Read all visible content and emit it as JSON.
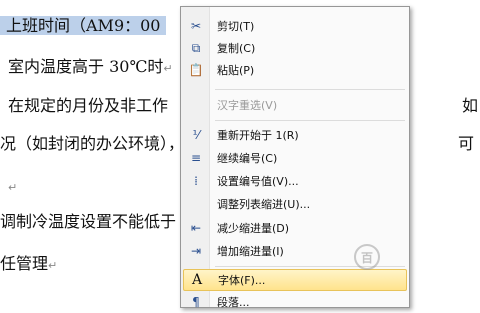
{
  "document": {
    "lines": [
      {
        "text": "上班时间（AM9：00"
      },
      {
        "text": "室内温度高于 30℃时"
      },
      {
        "text": "在规定的月份及非工作"
      },
      {
        "text": "况（如封闭的办公环境），"
      },
      {
        "text": ""
      },
      {
        "text": "调制冷温度设置不能低于"
      },
      {
        "text": "任管理"
      }
    ],
    "right_fragments": {
      "a": "如",
      "b": "可"
    }
  },
  "context_menu": {
    "items": [
      {
        "label": "剪切(T)",
        "icon": "scissors-icon"
      },
      {
        "label": "复制(C)",
        "icon": "copy-icon"
      },
      {
        "label": "粘贴(P)",
        "icon": "paste-icon"
      },
      {
        "label": "汉字重选(V)",
        "icon": "",
        "disabled": true
      },
      {
        "label": "重新开始于 1(R)",
        "icon": "restart-numbering-icon"
      },
      {
        "label": "继续编号(C)",
        "icon": "continue-numbering-icon"
      },
      {
        "label": "设置编号值(V)...",
        "icon": "set-numbering-value-icon"
      },
      {
        "label": "调整列表缩进(U)...",
        "icon": ""
      },
      {
        "label": "减少缩进量(D)",
        "icon": "decrease-indent-icon"
      },
      {
        "label": "增加缩进量(I)",
        "icon": "increase-indent-icon"
      },
      {
        "label": "字体(F)...",
        "icon": "font-icon",
        "hover": true
      },
      {
        "label": "段落...",
        "icon": "paragraph-icon"
      }
    ]
  },
  "colors": {
    "selection": "#bcd0ea",
    "menu_hover": "#ffe38c",
    "menu_icon": "#2a4f8f"
  }
}
